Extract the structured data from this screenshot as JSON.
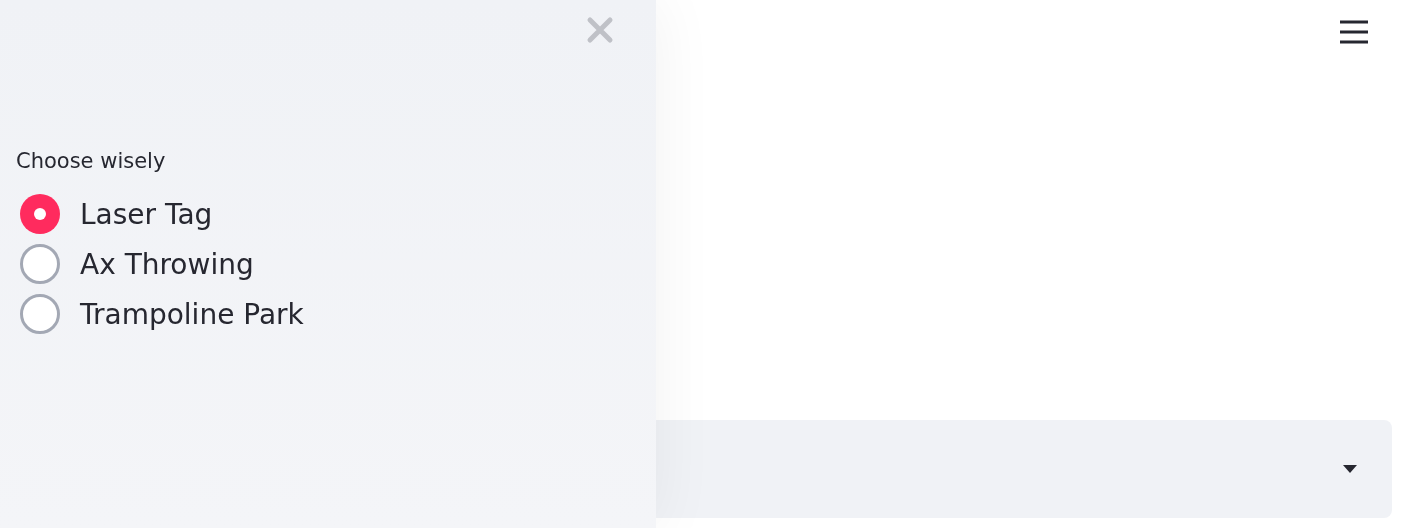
{
  "sidebar": {
    "radio_group": {
      "label": "Choose wisely",
      "options": [
        {
          "label": "Laser Tag",
          "selected": true
        },
        {
          "label": "Ax Throwing",
          "selected": false
        },
        {
          "label": "Trampoline Park",
          "selected": false
        }
      ]
    }
  }
}
